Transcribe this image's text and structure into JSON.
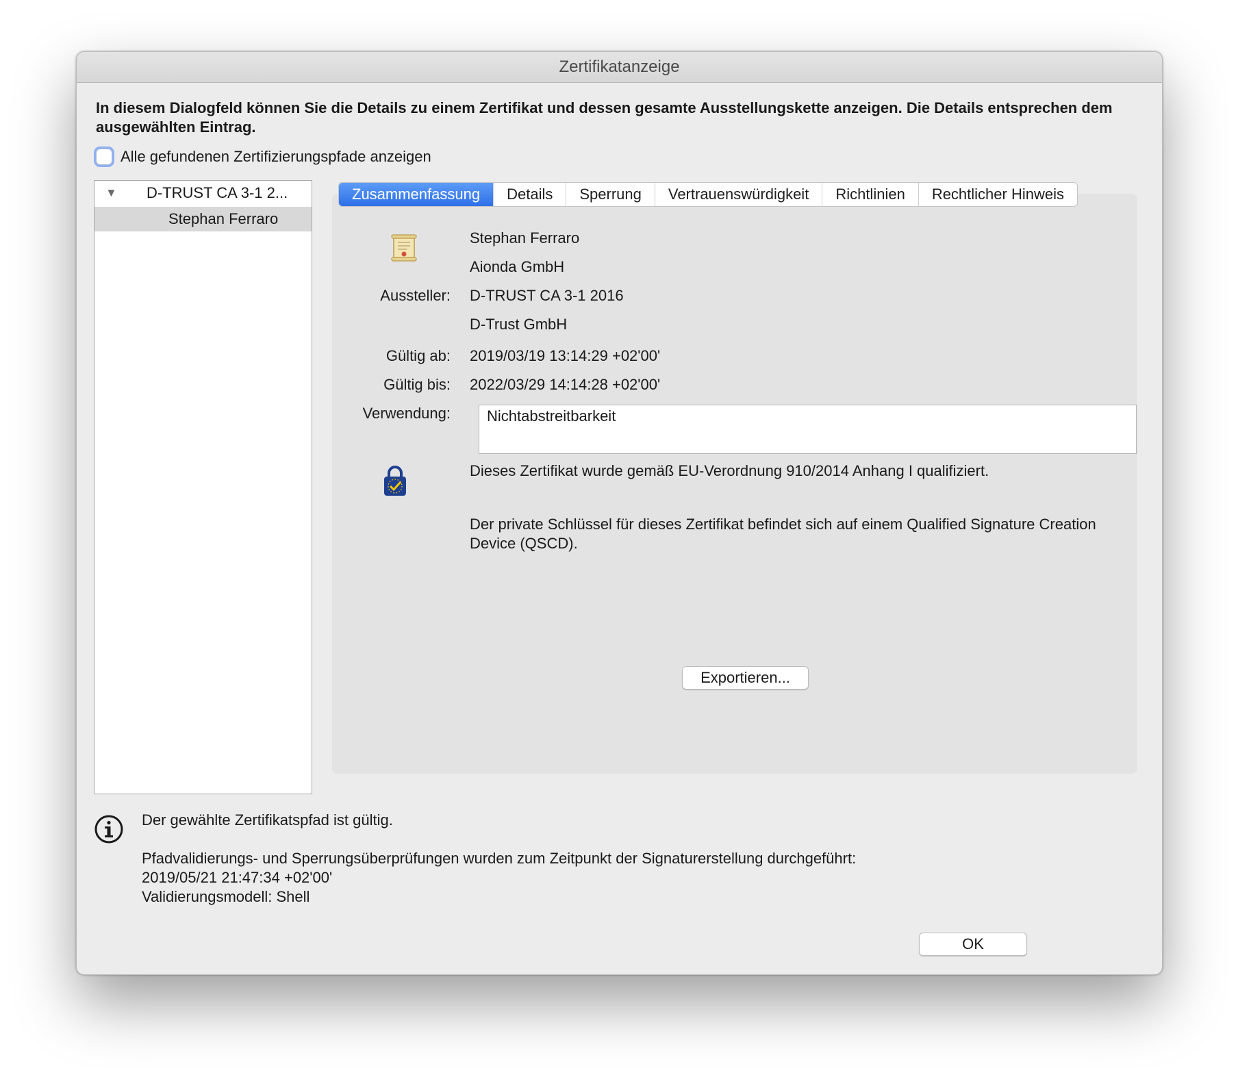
{
  "window": {
    "title": "Zertifikatanzeige"
  },
  "intro": {
    "text": "In diesem Dialogfeld können Sie die Details zu einem Zertifikat und dessen gesamte Ausstellungskette anzeigen. Die Details entsprechen dem ausgewählten Eintrag."
  },
  "show_all_paths": {
    "label": "Alle gefundenen Zertifizierungspfade anzeigen",
    "checked": false
  },
  "tree": {
    "root": {
      "label": "D-TRUST CA 3-1 2...",
      "expanded": true
    },
    "child": {
      "label": "Stephan Ferraro",
      "selected": true
    }
  },
  "tabs": [
    {
      "label": "Zusammenfassung",
      "active": true
    },
    {
      "label": "Details"
    },
    {
      "label": "Sperrung"
    },
    {
      "label": "Vertrauenswürdigkeit"
    },
    {
      "label": "Richtlinien"
    },
    {
      "label": "Rechtlicher Hinweis"
    }
  ],
  "summary": {
    "icon": "certificate-icon",
    "subject_name": "Stephan Ferraro",
    "subject_org": "Aionda GmbH",
    "issuer_label": "Aussteller:",
    "issuer_name": "D-TRUST CA 3-1 2016",
    "issuer_org": "D-Trust GmbH",
    "valid_from_label": "Gültig ab:",
    "valid_from": "2019/03/19 13:14:29 +02'00'",
    "valid_to_label": "Gültig bis:",
    "valid_to": "2022/03/29 14:14:28 +02'00'",
    "usage_label": "Verwendung:",
    "usage": "Nichtabstreitbarkeit",
    "eu_icon": "eu-trust-lock-icon",
    "eu_text": "Dieses Zertifikat wurde gemäß EU-Verordnung 910/2014 Anhang I qualifiziert.",
    "qscd_text": "Der private Schlüssel für dieses Zertifikat befindet sich auf einem Qualified Signature Creation Device (QSCD).",
    "export_button": "Exportieren..."
  },
  "status": {
    "icon": "info-icon",
    "valid_text": "Der gewählte Zertifikatspfad ist gültig.",
    "check_text": "Pfadvalidierungs- und Sperrungsüberprüfungen wurden zum Zeitpunkt der Signaturerstellung durchgeführt:",
    "check_time": "2019/05/21 21:47:34 +02'00'",
    "model": "Validierungsmodell: Shell"
  },
  "buttons": {
    "ok": "OK"
  }
}
